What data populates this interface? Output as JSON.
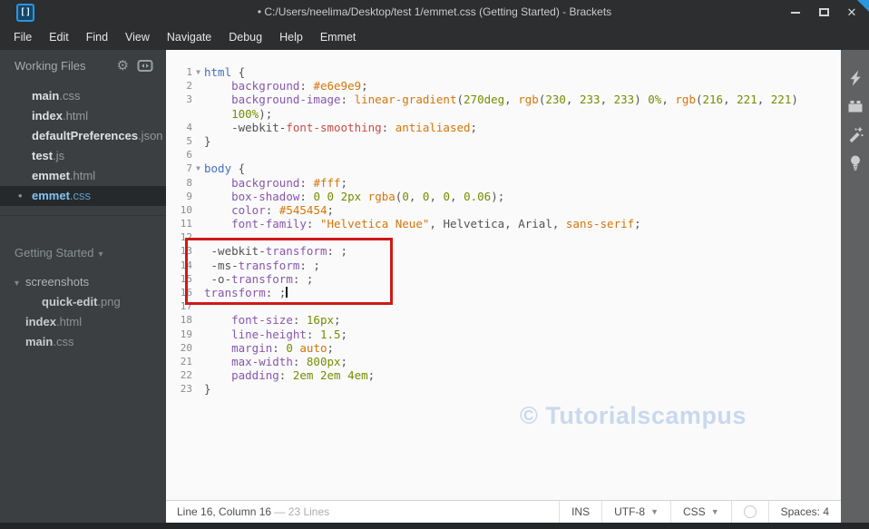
{
  "window": {
    "title": "• C:/Users/neelima/Desktop/test 1/emmet.css (Getting Started) - Brackets",
    "logo_glyph": "[]"
  },
  "menu": [
    "File",
    "Edit",
    "Find",
    "View",
    "Navigate",
    "Debug",
    "Help",
    "Emmet"
  ],
  "sidebar": {
    "working_files_label": "Working Files",
    "working_files": [
      {
        "name": "main",
        "ext": ".css"
      },
      {
        "name": "index",
        "ext": ".html"
      },
      {
        "name": "defaultPreferences",
        "ext": ".json"
      },
      {
        "name": "test",
        "ext": ".js"
      },
      {
        "name": "emmet",
        "ext": ".html"
      },
      {
        "name": "emmet",
        "ext": ".css",
        "active": true
      }
    ],
    "project_label": "Getting Started",
    "tree": [
      {
        "label": "screenshots",
        "folder": true,
        "expanded": true,
        "indent": 0
      },
      {
        "name": "quick-edit",
        "ext": ".png",
        "indent": 1
      },
      {
        "name": "index",
        "ext": ".html",
        "indent": 0
      },
      {
        "name": "main",
        "ext": ".css",
        "indent": 0
      }
    ]
  },
  "editor": {
    "watermark": "© Tutorialscampus",
    "rows": [
      {
        "n": "1",
        "fold": true,
        "segs": [
          [
            "tag",
            "html"
          ],
          [
            "t",
            " {"
          ]
        ]
      },
      {
        "n": "2",
        "segs": [
          [
            "t",
            "    "
          ],
          [
            "p",
            "background"
          ],
          [
            "t",
            ": "
          ],
          [
            "a",
            "#e6e9e9"
          ],
          [
            "t",
            ";"
          ]
        ]
      },
      {
        "n": "3",
        "segs": [
          [
            "t",
            "    "
          ],
          [
            "p",
            "background-image"
          ],
          [
            "t",
            ": "
          ],
          [
            "a",
            "linear-gradient"
          ],
          [
            "t",
            "("
          ],
          [
            "n",
            "270deg"
          ],
          [
            "t",
            ", "
          ],
          [
            "a",
            "rgb"
          ],
          [
            "t",
            "("
          ],
          [
            "n",
            "230"
          ],
          [
            "t",
            ", "
          ],
          [
            "n",
            "233"
          ],
          [
            "t",
            ", "
          ],
          [
            "n",
            "233"
          ],
          [
            "t",
            ") "
          ],
          [
            "n",
            "0%"
          ],
          [
            "t",
            ", "
          ],
          [
            "a",
            "rgb"
          ],
          [
            "t",
            "("
          ],
          [
            "n",
            "216"
          ],
          [
            "t",
            ", "
          ],
          [
            "n",
            "221"
          ],
          [
            "t",
            ", "
          ],
          [
            "n",
            "221"
          ],
          [
            "t",
            ")"
          ]
        ]
      },
      {
        "n": "",
        "segs": [
          [
            "t",
            "    "
          ],
          [
            "n",
            "100%"
          ],
          [
            "t",
            ");"
          ]
        ]
      },
      {
        "n": "4",
        "segs": [
          [
            "t",
            "    -webkit-"
          ],
          [
            "e",
            "font-smoothing"
          ],
          [
            "t",
            ": "
          ],
          [
            "a",
            "antialiased"
          ],
          [
            "t",
            ";"
          ]
        ]
      },
      {
        "n": "5",
        "segs": [
          [
            "t",
            "}"
          ]
        ]
      },
      {
        "n": "6",
        "segs": []
      },
      {
        "n": "7",
        "fold": true,
        "segs": [
          [
            "tag",
            "body"
          ],
          [
            "t",
            " {"
          ]
        ]
      },
      {
        "n": "8",
        "segs": [
          [
            "t",
            "    "
          ],
          [
            "p",
            "background"
          ],
          [
            "t",
            ": "
          ],
          [
            "a",
            "#fff"
          ],
          [
            "t",
            ";"
          ]
        ]
      },
      {
        "n": "9",
        "segs": [
          [
            "t",
            "    "
          ],
          [
            "p",
            "box-shadow"
          ],
          [
            "t",
            ": "
          ],
          [
            "n",
            "0"
          ],
          [
            "t",
            " "
          ],
          [
            "n",
            "0"
          ],
          [
            "t",
            " "
          ],
          [
            "n",
            "2px"
          ],
          [
            "t",
            " "
          ],
          [
            "a",
            "rgba"
          ],
          [
            "t",
            "("
          ],
          [
            "n",
            "0"
          ],
          [
            "t",
            ", "
          ],
          [
            "n",
            "0"
          ],
          [
            "t",
            ", "
          ],
          [
            "n",
            "0"
          ],
          [
            "t",
            ", "
          ],
          [
            "n",
            "0.06"
          ],
          [
            "t",
            ");"
          ]
        ]
      },
      {
        "n": "10",
        "segs": [
          [
            "t",
            "    "
          ],
          [
            "p",
            "color"
          ],
          [
            "t",
            ": "
          ],
          [
            "a",
            "#545454"
          ],
          [
            "t",
            ";"
          ]
        ]
      },
      {
        "n": "11",
        "segs": [
          [
            "t",
            "    "
          ],
          [
            "p",
            "font-family"
          ],
          [
            "t",
            ": "
          ],
          [
            "s",
            "\"Helvetica Neue\""
          ],
          [
            "t",
            ", Helvetica, Arial, "
          ],
          [
            "a",
            "sans-serif"
          ],
          [
            "t",
            ";"
          ]
        ]
      },
      {
        "n": "12",
        "segs": []
      },
      {
        "n": "13",
        "segs": [
          [
            "t",
            " -webkit-"
          ],
          [
            "p",
            "transform"
          ],
          [
            "t",
            ": ;"
          ]
        ]
      },
      {
        "n": "14",
        "segs": [
          [
            "t",
            " -ms-"
          ],
          [
            "p",
            "transform"
          ],
          [
            "t",
            ": ;"
          ]
        ]
      },
      {
        "n": "15",
        "segs": [
          [
            "t",
            " -o-"
          ],
          [
            "p",
            "transform"
          ],
          [
            "t",
            ": ;"
          ]
        ]
      },
      {
        "n": "16",
        "cursor": true,
        "segs": [
          [
            "p",
            "transform"
          ],
          [
            "t",
            ": ;"
          ]
        ]
      },
      {
        "n": "17",
        "segs": []
      },
      {
        "n": "18",
        "segs": [
          [
            "t",
            "    "
          ],
          [
            "p",
            "font-size"
          ],
          [
            "t",
            ": "
          ],
          [
            "n",
            "16px"
          ],
          [
            "t",
            ";"
          ]
        ]
      },
      {
        "n": "19",
        "segs": [
          [
            "t",
            "    "
          ],
          [
            "p",
            "line-height"
          ],
          [
            "t",
            ": "
          ],
          [
            "n",
            "1.5"
          ],
          [
            "t",
            ";"
          ]
        ]
      },
      {
        "n": "20",
        "segs": [
          [
            "t",
            "    "
          ],
          [
            "p",
            "margin"
          ],
          [
            "t",
            ": "
          ],
          [
            "n",
            "0"
          ],
          [
            "t",
            " "
          ],
          [
            "a",
            "auto"
          ],
          [
            "t",
            ";"
          ]
        ]
      },
      {
        "n": "21",
        "segs": [
          [
            "t",
            "    "
          ],
          [
            "p",
            "max-width"
          ],
          [
            "t",
            ": "
          ],
          [
            "n",
            "800px"
          ],
          [
            "t",
            ";"
          ]
        ]
      },
      {
        "n": "22",
        "segs": [
          [
            "t",
            "    "
          ],
          [
            "p",
            "padding"
          ],
          [
            "t",
            ": "
          ],
          [
            "n",
            "2em"
          ],
          [
            "t",
            " "
          ],
          [
            "n",
            "2em"
          ],
          [
            "t",
            " "
          ],
          [
            "n",
            "4em"
          ],
          [
            "t",
            ";"
          ]
        ]
      },
      {
        "n": "23",
        "segs": [
          [
            "t",
            "}"
          ]
        ]
      }
    ]
  },
  "toolbar_icons": [
    "live-preview",
    "extension-manager",
    "beautify-wand",
    "lightbulb"
  ],
  "status_bar": {
    "cursor_position": "Line 16, Column 16",
    "separator": "—",
    "line_count": "23 Lines",
    "insert_mode": "INS",
    "encoding": "UTF-8",
    "language": "CSS",
    "spaces": "Spaces: 4"
  },
  "colors": {
    "titlebar_bg": "#2c2e30",
    "sidebar_bg": "#3c3f41",
    "sidebar_active_bg": "#26292b",
    "sidebar_active_text": "#82c3f3",
    "editor_bg": "#fafafa",
    "toolbar_bg": "#5f6163",
    "annotation_red": "#d01818",
    "watermark": "#c8d9ee",
    "logo_blue": "#2a96de",
    "syntax_property": "#8757ad",
    "syntax_atom": "#d47509",
    "syntax_number": "#738d00",
    "syntax_text": "#535353",
    "syntax_tag": "#446fbd",
    "syntax_error": "#cb4b44"
  }
}
